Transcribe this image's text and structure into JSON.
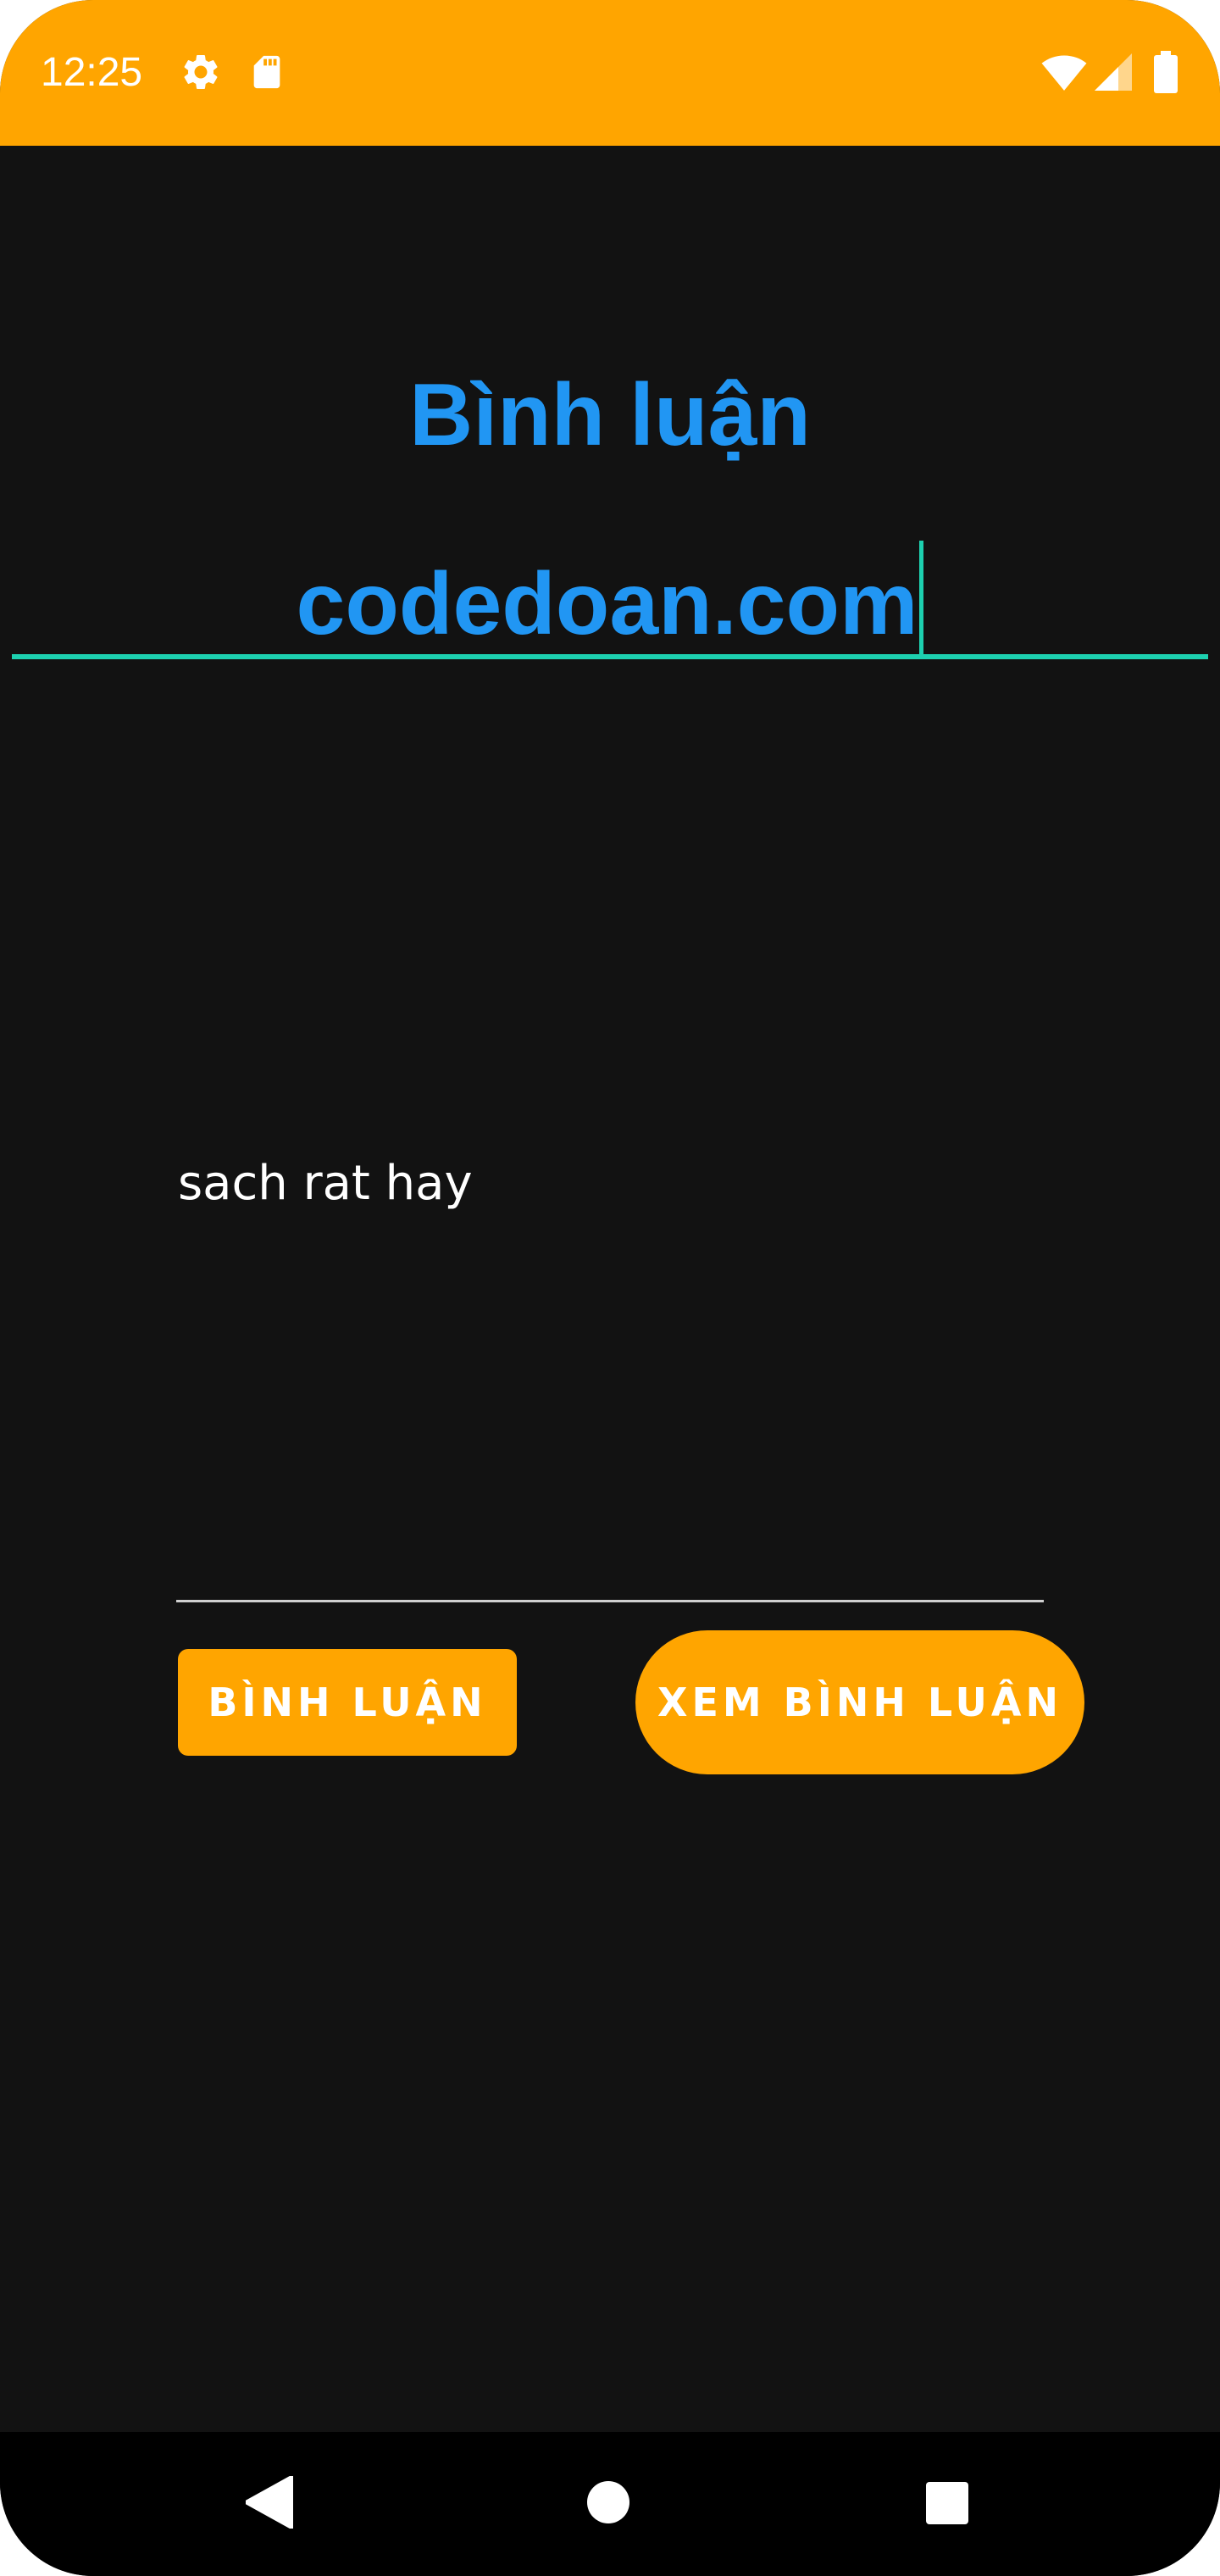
{
  "status_bar": {
    "time": "12:25",
    "icons": [
      "gear-icon",
      "sd-card-icon",
      "wifi-icon",
      "cellular-signal-icon",
      "battery-icon"
    ],
    "background_color": "#FFA500"
  },
  "screen": {
    "title": "Bình luận",
    "site_field": {
      "value": "codedoan.com"
    },
    "comment_field": {
      "value": "sach rat hay"
    },
    "buttons": {
      "comment_label": "BÌNH LUẬN",
      "view_comments_label": "XEM BÌNH LUẬN"
    },
    "colors": {
      "background": "#121212",
      "title": "#2196F3",
      "accent_underline": "#1DD1B0",
      "button": "#FFA500"
    }
  },
  "nav_bar": {
    "buttons": [
      "back-icon",
      "home-icon",
      "recents-icon"
    ]
  }
}
